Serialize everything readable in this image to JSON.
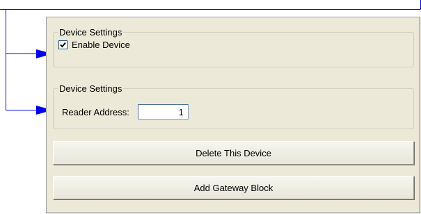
{
  "group_enable": {
    "legend": "Device Settings",
    "checkbox_label": "Enable Device",
    "checked": true
  },
  "group_address": {
    "legend": "Device Settings",
    "address_label": "Reader Address:",
    "address_value": "1"
  },
  "buttons": {
    "delete_label": "Delete This Device",
    "gateway_label": "Add Gateway Block"
  },
  "colors": {
    "callout": "#0000ee",
    "panel_bg": "#ece9d8"
  }
}
